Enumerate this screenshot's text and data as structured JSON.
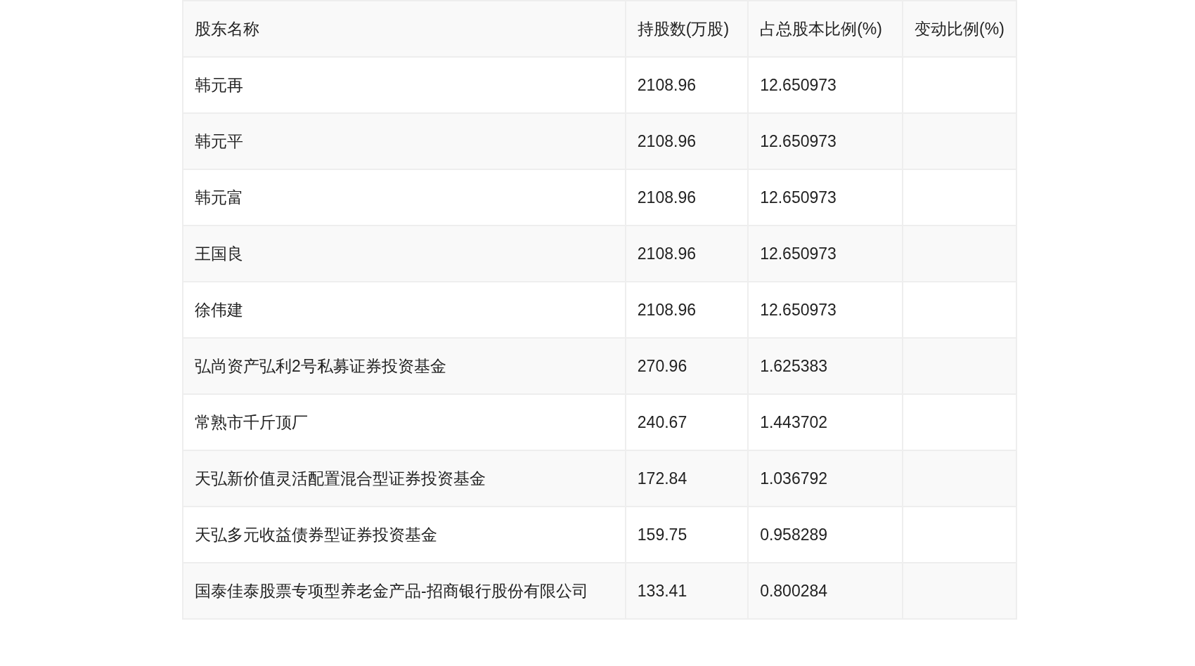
{
  "table": {
    "columns": [
      "股东名称",
      "持股数(万股)",
      "占总股本比例(%)",
      "变动比例(%)"
    ],
    "rows": [
      {
        "name": "韩元再",
        "shares": "2108.96",
        "ratio": "12.650973"
      },
      {
        "name": "韩元平",
        "shares": "2108.96",
        "ratio": "12.650973"
      },
      {
        "name": "韩元富",
        "shares": "2108.96",
        "ratio": "12.650973"
      },
      {
        "name": "王国良",
        "shares": "2108.96",
        "ratio": "12.650973"
      },
      {
        "name": "徐伟建",
        "shares": "2108.96",
        "ratio": "12.650973"
      },
      {
        "name": "弘尚资产弘利2号私募证券投资基金",
        "shares": "270.96",
        "ratio": "1.625383"
      },
      {
        "name": "常熟市千斤顶厂",
        "shares": "240.67",
        "ratio": "1.443702"
      },
      {
        "name": "天弘新价值灵活配置混合型证券投资基金",
        "shares": "172.84",
        "ratio": "1.036792"
      },
      {
        "name": "天弘多元收益债券型证券投资基金",
        "shares": "159.75",
        "ratio": "0.958289"
      },
      {
        "name": "国泰佳泰股票专项型养老金产品-招商银行股份有限公司",
        "shares": "133.41",
        "ratio": "0.800284"
      }
    ]
  }
}
